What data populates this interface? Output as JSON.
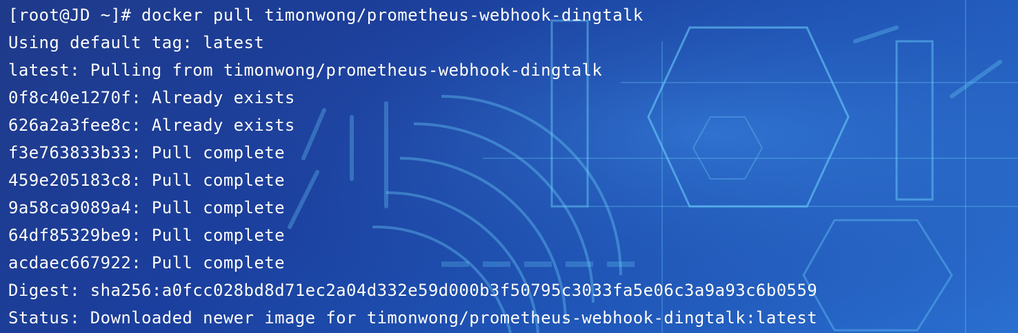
{
  "terminal": {
    "lines": [
      "[root@JD ~]# docker pull timonwong/prometheus-webhook-dingtalk",
      "Using default tag: latest",
      "latest: Pulling from timonwong/prometheus-webhook-dingtalk",
      "0f8c40e1270f: Already exists",
      "626a2a3fee8c: Already exists",
      "f3e763833b33: Pull complete",
      "459e205183c8: Pull complete",
      "9a58ca9089a4: Pull complete",
      "64df85329be9: Pull complete",
      "acdaec667922: Pull complete",
      "Digest: sha256:a0fcc028bd8d71ec2a04d332e59d000b3f50795c3033fa5e06c3a9a93c6b0559",
      "Status: Downloaded newer image for timonwong/prometheus-webhook-dingtalk:latest"
    ]
  },
  "colors": {
    "background_dark": "#1f3a8a",
    "background_light": "#2a6fd0",
    "text": "#ffffff",
    "art_line": "#6fd6ff"
  }
}
